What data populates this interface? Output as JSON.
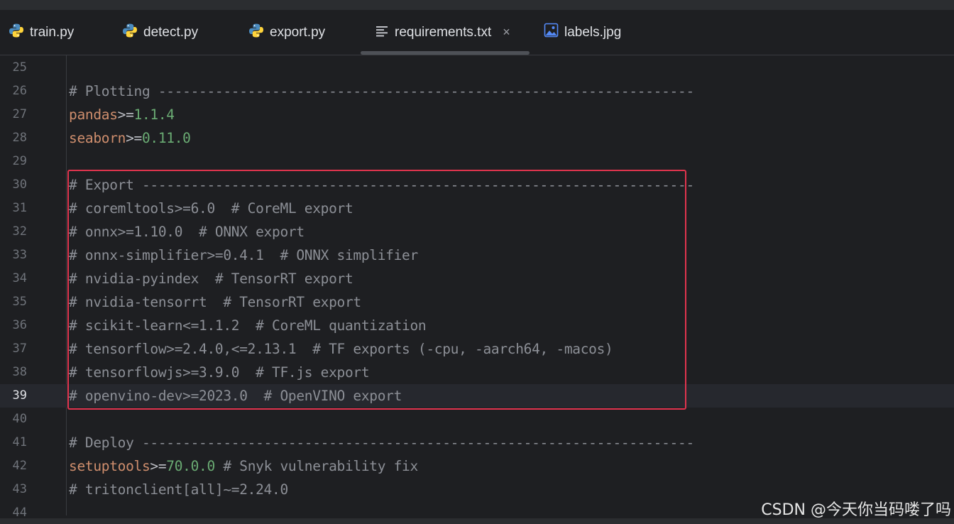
{
  "tabs": [
    {
      "label": "train.py",
      "icon": "python-icon",
      "active": false
    },
    {
      "label": "detect.py",
      "icon": "python-icon",
      "active": false
    },
    {
      "label": "export.py",
      "icon": "python-icon",
      "active": false
    },
    {
      "label": "requirements.txt",
      "icon": "text-file-icon",
      "active": true
    },
    {
      "label": "labels.jpg",
      "icon": "image-file-icon",
      "active": false
    }
  ],
  "close_glyph": "×",
  "current_line": 39,
  "lines": [
    {
      "n": "25",
      "segs": []
    },
    {
      "n": "26",
      "segs": [
        {
          "t": "# Plotting ------------------------------------------------------------------",
          "k": "comment"
        }
      ]
    },
    {
      "n": "27",
      "segs": [
        {
          "t": "pandas",
          "k": "key"
        },
        {
          "t": ">=",
          "k": "op"
        },
        {
          "t": "1.1.4",
          "k": "ver"
        }
      ]
    },
    {
      "n": "28",
      "segs": [
        {
          "t": "seaborn",
          "k": "key"
        },
        {
          "t": ">=",
          "k": "op"
        },
        {
          "t": "0.11.0",
          "k": "ver"
        }
      ]
    },
    {
      "n": "29",
      "segs": []
    },
    {
      "n": "30",
      "segs": [
        {
          "t": "# Export --------------------------------------------------------------------",
          "k": "comment"
        }
      ]
    },
    {
      "n": "31",
      "segs": [
        {
          "t": "# coremltools>=6.0  # CoreML export",
          "k": "comment"
        }
      ]
    },
    {
      "n": "32",
      "segs": [
        {
          "t": "# onnx>=1.10.0  # ONNX export",
          "k": "comment"
        }
      ]
    },
    {
      "n": "33",
      "segs": [
        {
          "t": "# onnx-simplifier>=0.4.1  # ONNX simplifier",
          "k": "comment"
        }
      ]
    },
    {
      "n": "34",
      "segs": [
        {
          "t": "# nvidia-pyindex  # TensorRT export",
          "k": "comment"
        }
      ]
    },
    {
      "n": "35",
      "segs": [
        {
          "t": "# nvidia-tensorrt  # TensorRT export",
          "k": "comment"
        }
      ]
    },
    {
      "n": "36",
      "segs": [
        {
          "t": "# scikit-learn<=1.1.2  # CoreML quantization",
          "k": "comment"
        }
      ]
    },
    {
      "n": "37",
      "segs": [
        {
          "t": "# tensorflow>=2.4.0,<=2.13.1  # TF exports (-cpu, -aarch64, -macos)",
          "k": "comment"
        }
      ]
    },
    {
      "n": "38",
      "segs": [
        {
          "t": "# tensorflowjs>=3.9.0  # TF.js export",
          "k": "comment"
        }
      ]
    },
    {
      "n": "39",
      "segs": [
        {
          "t": "# openvino-dev>=2023.0  # OpenVINO export",
          "k": "comment"
        }
      ]
    },
    {
      "n": "40",
      "segs": []
    },
    {
      "n": "41",
      "segs": [
        {
          "t": "# Deploy --------------------------------------------------------------------",
          "k": "comment"
        }
      ]
    },
    {
      "n": "42",
      "segs": [
        {
          "t": "setuptools",
          "k": "key"
        },
        {
          "t": ">=",
          "k": "op"
        },
        {
          "t": "70.0.0",
          "k": "ver"
        },
        {
          "t": " # Snyk vulnerability fix",
          "k": "comment"
        }
      ]
    },
    {
      "n": "43",
      "segs": [
        {
          "t": "# tritonclient[all]~=2.24.0",
          "k": "comment"
        }
      ]
    },
    {
      "n": "44",
      "segs": []
    }
  ],
  "watermark": "CSDN @今天你当码喽了吗",
  "colors": {
    "background": "#1e1f22",
    "comment": "#8c8f96",
    "package": "#cf8e6d",
    "version": "#6aab73",
    "highlight_box": "#e0344e"
  }
}
